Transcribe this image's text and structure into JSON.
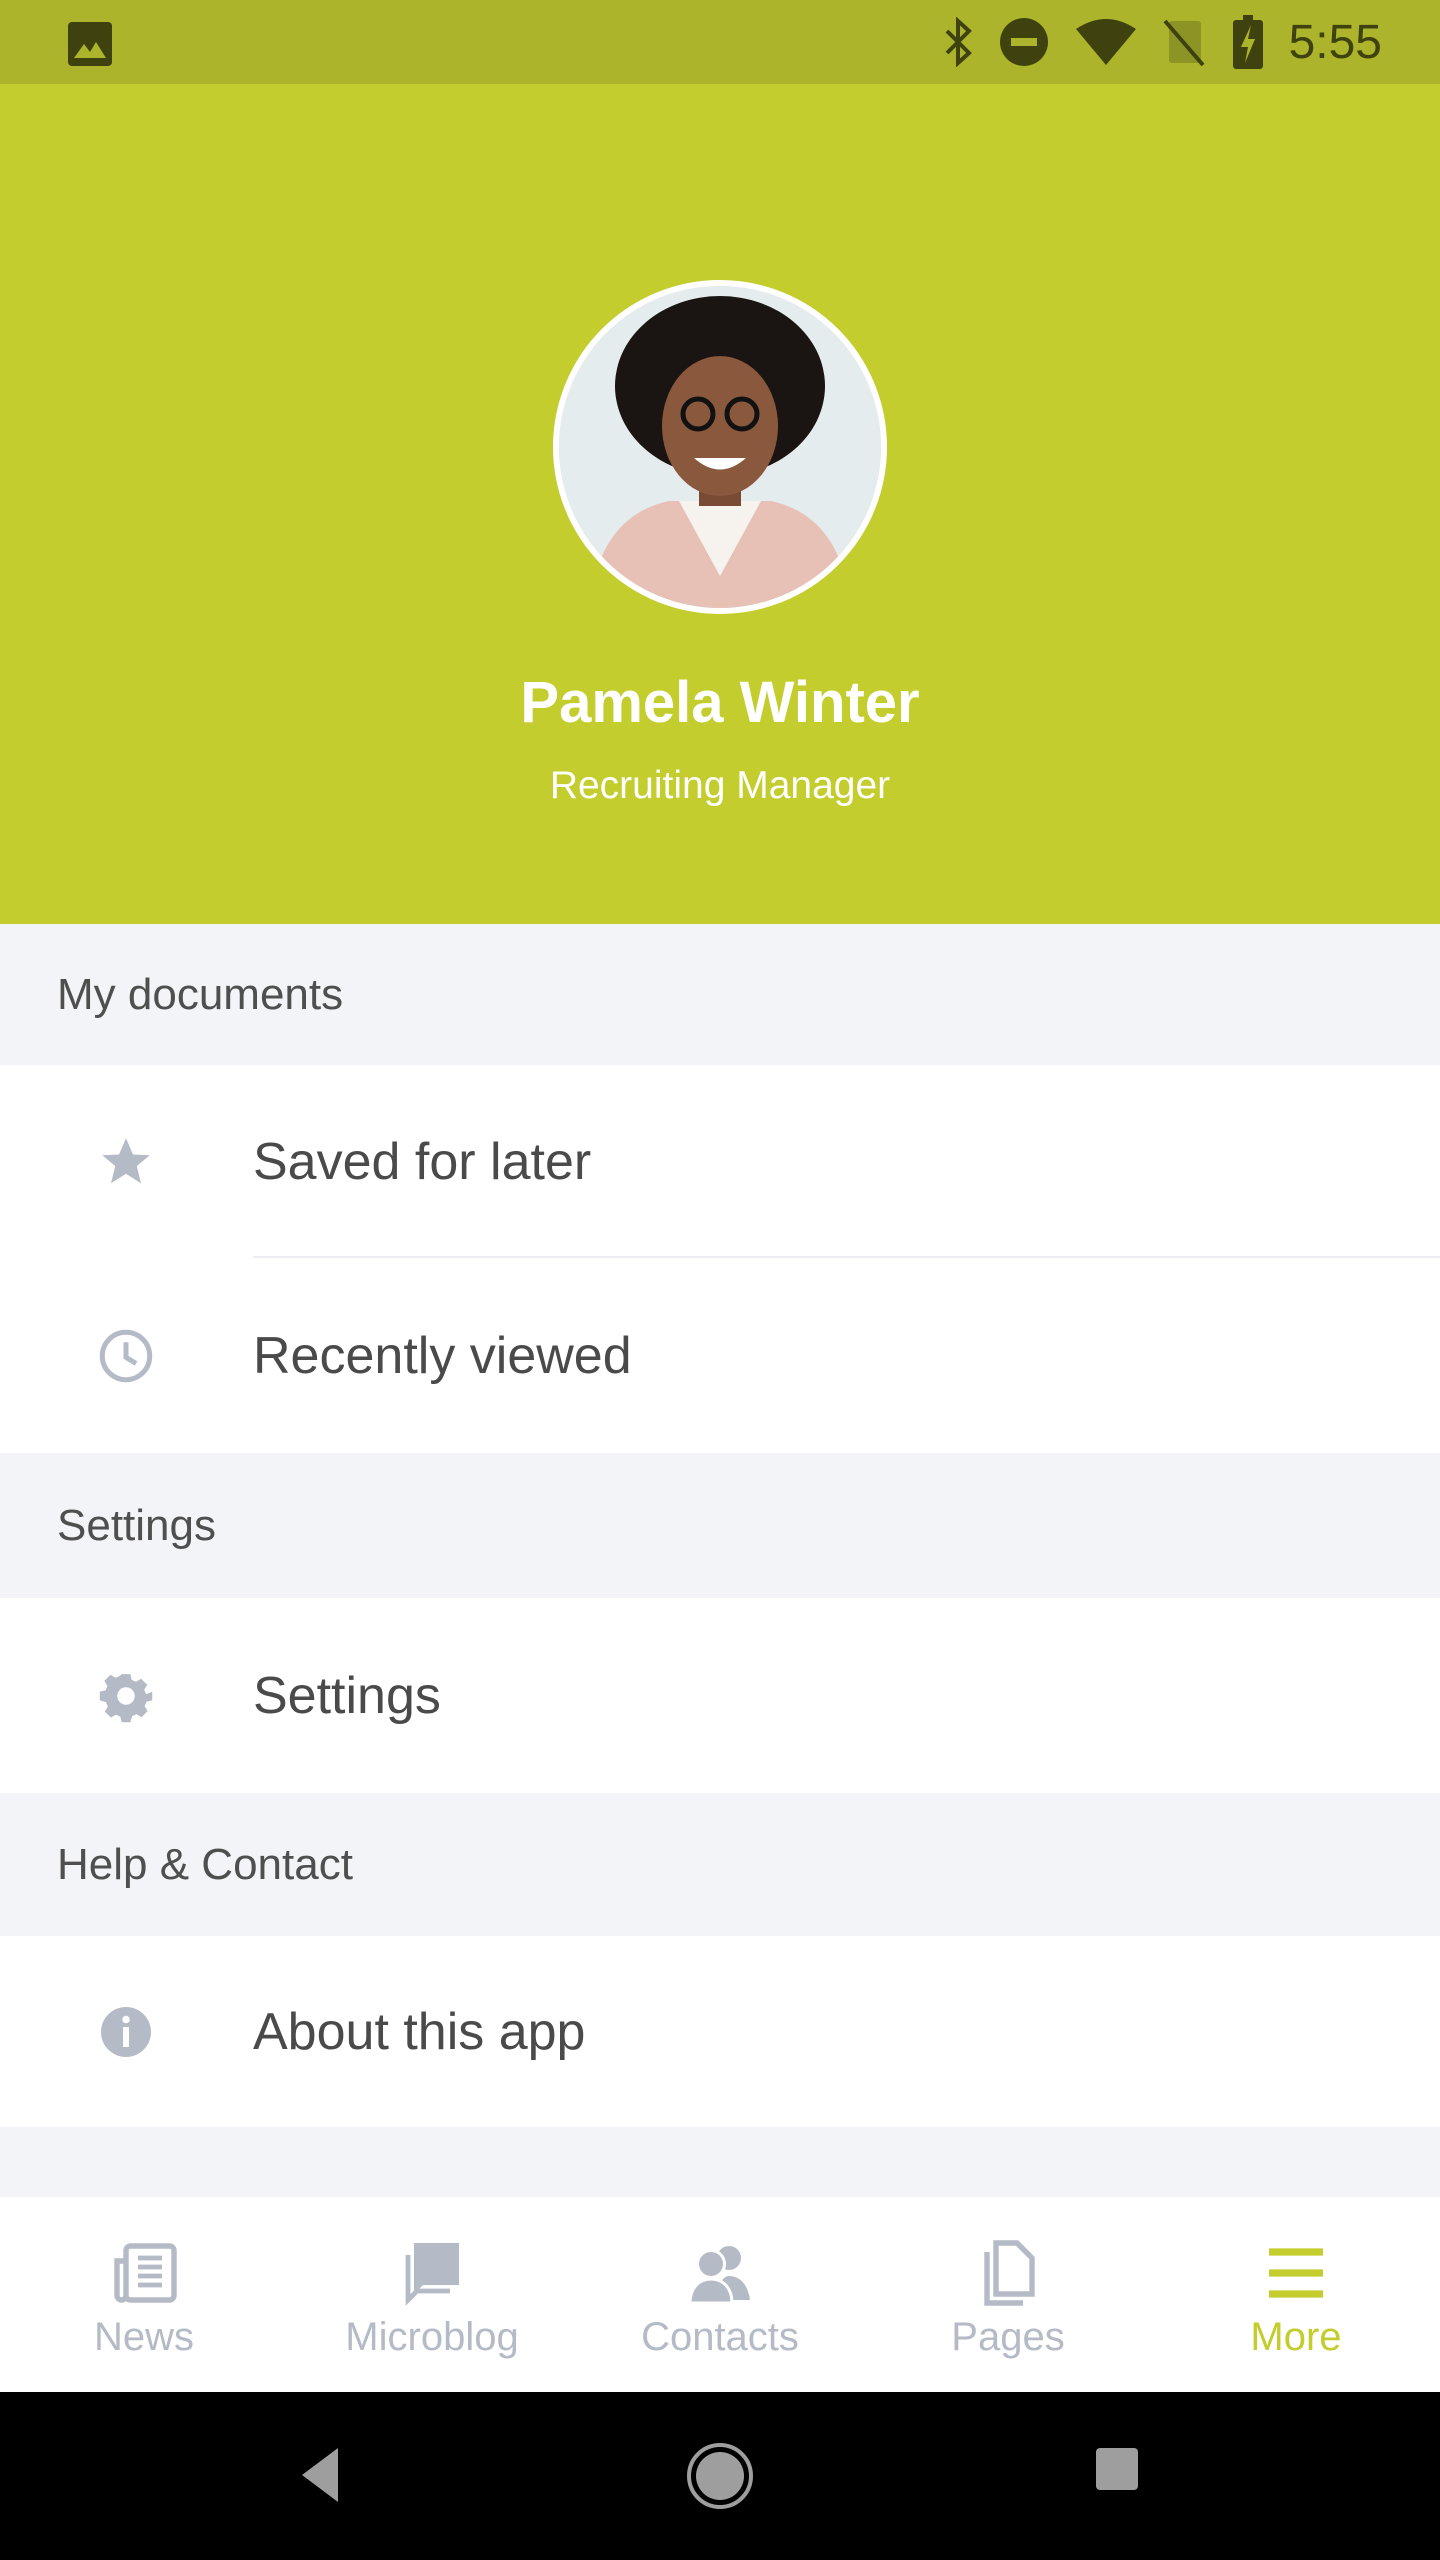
{
  "status_bar": {
    "time": "5:55",
    "icons": [
      "image-icon",
      "bluetooth-icon",
      "do-not-disturb-icon",
      "wifi-icon",
      "no-sim-icon",
      "battery-charging-icon"
    ]
  },
  "profile": {
    "name": "Pamela Winter",
    "role": "Recruiting Manager"
  },
  "sections": [
    {
      "title": "My documents",
      "items": [
        {
          "label": "Saved for later",
          "icon": "star-icon"
        },
        {
          "label": "Recently viewed",
          "icon": "clock-icon"
        }
      ]
    },
    {
      "title": "Settings",
      "items": [
        {
          "label": "Settings",
          "icon": "gear-icon"
        }
      ]
    },
    {
      "title": "Help & Contact",
      "items": [
        {
          "label": "About this app",
          "icon": "info-icon"
        }
      ]
    }
  ],
  "bottom_nav": {
    "active": "More",
    "items": [
      {
        "label": "News"
      },
      {
        "label": "Microblog"
      },
      {
        "label": "Contacts"
      },
      {
        "label": "Pages"
      },
      {
        "label": "More"
      }
    ]
  },
  "colors": {
    "accent": "#c3cd2d",
    "status_bar": "#abb42a",
    "icon_gray": "#b4bac6",
    "section_bg": "#f3f4f8"
  }
}
